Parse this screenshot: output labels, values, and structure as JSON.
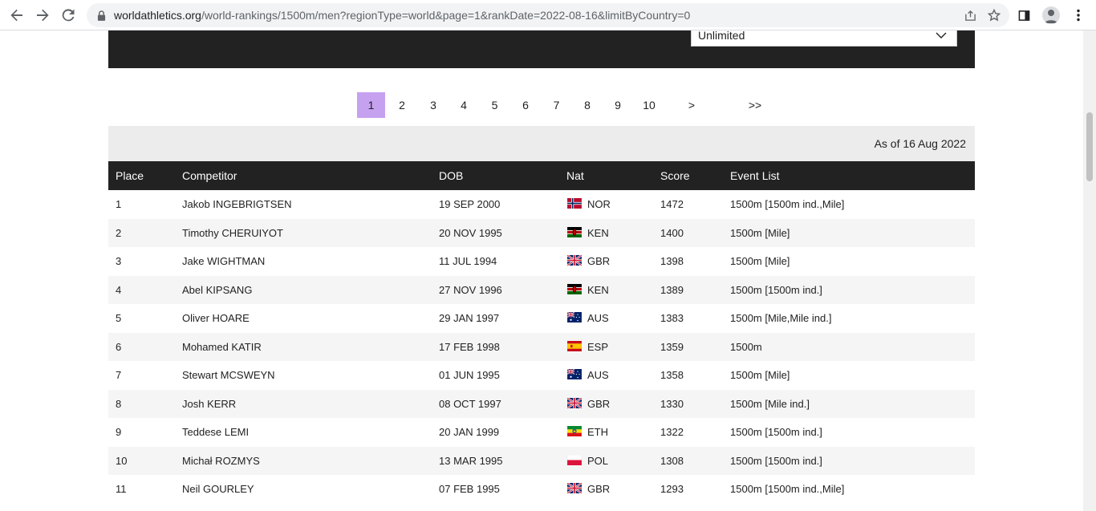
{
  "browser": {
    "url_host": "worldathletics.org",
    "url_path": "/world-rankings/1500m/men?regionType=world&page=1&rankDate=2022-08-16&limitByCountry=0"
  },
  "filter": {
    "select_value": "Unlimited"
  },
  "pagination": {
    "pages": [
      "1",
      "2",
      "3",
      "4",
      "5",
      "6",
      "7",
      "8",
      "9",
      "10"
    ],
    "active": "1",
    "next": ">",
    "last": ">>"
  },
  "rankings": {
    "as_of": "As of 16 Aug 2022",
    "headers": {
      "place": "Place",
      "competitor": "Competitor",
      "dob": "DOB",
      "nat": "Nat",
      "score": "Score",
      "events": "Event List"
    },
    "rows": [
      {
        "place": "1",
        "competitor": "Jakob INGEBRIGTSEN",
        "dob": "19 SEP 2000",
        "nat": "NOR",
        "score": "1472",
        "events": "1500m [1500m ind.,Mile]"
      },
      {
        "place": "2",
        "competitor": "Timothy CHERUIYOT",
        "dob": "20 NOV 1995",
        "nat": "KEN",
        "score": "1400",
        "events": "1500m [Mile]"
      },
      {
        "place": "3",
        "competitor": "Jake WIGHTMAN",
        "dob": "11 JUL 1994",
        "nat": "GBR",
        "score": "1398",
        "events": "1500m [Mile]"
      },
      {
        "place": "4",
        "competitor": "Abel KIPSANG",
        "dob": "27 NOV 1996",
        "nat": "KEN",
        "score": "1389",
        "events": "1500m [1500m ind.]"
      },
      {
        "place": "5",
        "competitor": "Oliver HOARE",
        "dob": "29 JAN 1997",
        "nat": "AUS",
        "score": "1383",
        "events": "1500m [Mile,Mile ind.]"
      },
      {
        "place": "6",
        "competitor": "Mohamed KATIR",
        "dob": "17 FEB 1998",
        "nat": "ESP",
        "score": "1359",
        "events": "1500m"
      },
      {
        "place": "7",
        "competitor": "Stewart MCSWEYN",
        "dob": "01 JUN 1995",
        "nat": "AUS",
        "score": "1358",
        "events": "1500m [Mile]"
      },
      {
        "place": "8",
        "competitor": "Josh KERR",
        "dob": "08 OCT 1997",
        "nat": "GBR",
        "score": "1330",
        "events": "1500m [Mile ind.]"
      },
      {
        "place": "9",
        "competitor": "Teddese LEMI",
        "dob": "20 JAN 1999",
        "nat": "ETH",
        "score": "1322",
        "events": "1500m [1500m ind.]"
      },
      {
        "place": "10",
        "competitor": "Michał ROZMYS",
        "dob": "13 MAR 1995",
        "nat": "POL",
        "score": "1308",
        "events": "1500m [1500m ind.]"
      },
      {
        "place": "11",
        "competitor": "Neil GOURLEY",
        "dob": "07 FEB 1995",
        "nat": "GBR",
        "score": "1293",
        "events": "1500m [1500m ind.,Mile]"
      }
    ]
  },
  "colors": {
    "accent": "#c6a1f0",
    "header_bg": "#222222",
    "stripe": "#f5f5f5"
  }
}
